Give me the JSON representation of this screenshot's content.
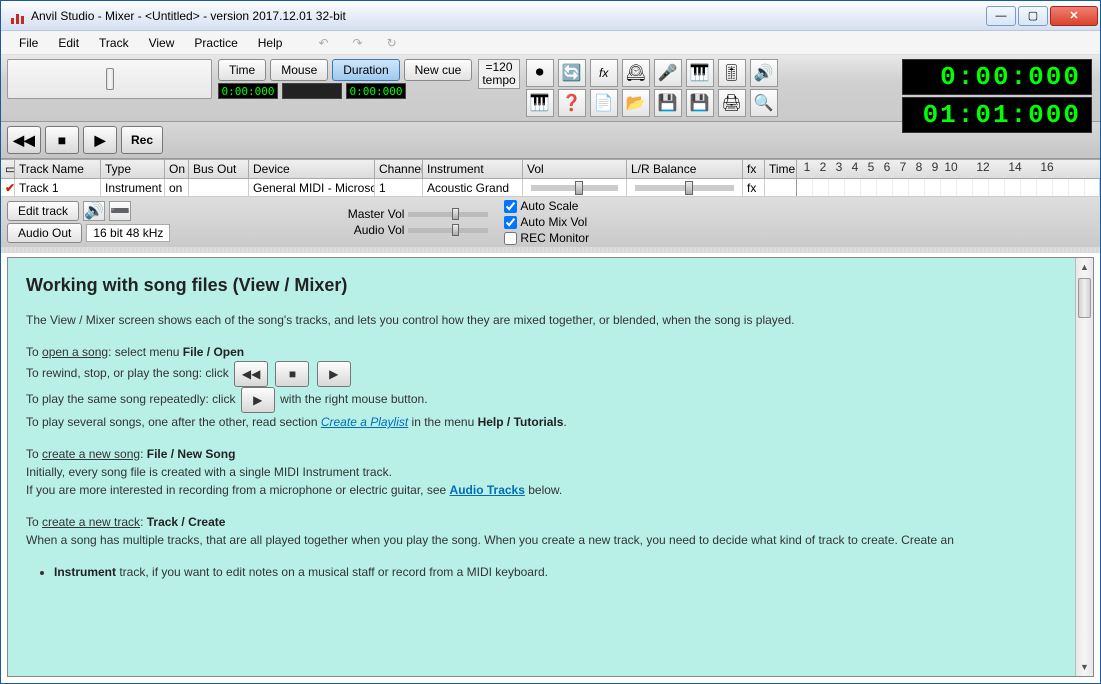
{
  "window": {
    "title": "Anvil Studio - Mixer - <Untitled> - version 2017.12.01 32-bit"
  },
  "menu": {
    "file": "File",
    "edit": "Edit",
    "track": "Track",
    "view": "View",
    "practice": "Practice",
    "help": "Help"
  },
  "toolbar": {
    "time": "Time",
    "mouse": "Mouse",
    "duration": "Duration",
    "newcue": "New cue",
    "time_counter": "0:00:000",
    "dur_counter": "0:00:000",
    "tempo_value": "=120",
    "tempo_label": "tempo",
    "rec": "Rec"
  },
  "bigtime": {
    "elapsed": "0:00:000",
    "position": "01:01:000"
  },
  "columns": {
    "trackname": "Track Name",
    "type": "Type",
    "on": "On",
    "busout": "Bus Out",
    "device": "Device",
    "channel": "Channel",
    "instrument": "Instrument",
    "vol": "Vol",
    "balance": "L/R Balance",
    "fx": "fx",
    "time": "Time"
  },
  "ruler": [
    "1",
    "2",
    "3",
    "4",
    "5",
    "6",
    "7",
    "8",
    "9",
    "10",
    "",
    "12",
    "",
    "14",
    "",
    "16"
  ],
  "track1": {
    "name": "Track 1",
    "type": "Instrument",
    "on": "on",
    "busout": "",
    "device": "General MIDI - Microso",
    "channel": "1",
    "instrument": "Acoustic Grand",
    "fx": "fx"
  },
  "mid": {
    "edit_track": "Edit track",
    "audio_out": "Audio Out",
    "audio_fmt": "16 bit 48 kHz",
    "master_vol": "Master Vol",
    "audio_vol": "Audio Vol",
    "auto_scale": "Auto Scale",
    "auto_mix": "Auto Mix Vol",
    "rec_monitor": "REC Monitor"
  },
  "help": {
    "heading": "Working with song files (View / Mixer)",
    "p1": "The View / Mixer screen shows each of the song's tracks, and lets you control how they are mixed together, or blended, when the song is played.",
    "open_pre": "To ",
    "open_u": "open a song",
    "open_post": ": select menu ",
    "open_b": "File / Open",
    "rewind": "To rewind, stop, or play the song: click ",
    "repeat_pre": "To play the same song repeatedly: click ",
    "repeat_post": " with the right mouse button.",
    "playlist_pre": "To play several songs, one after the other, read section ",
    "playlist_link": "Create a Playlist",
    "playlist_mid": " in the menu ",
    "playlist_b": "Help / Tutorials",
    "playlist_post": ".",
    "newsong_pre": "To ",
    "newsong_u": "create a new song",
    "newsong_post": ": ",
    "newsong_b": "File / New Song",
    "newsong_l1": "Initially, every song file is created with a single MIDI Instrument track.",
    "newsong_l2a": "If you are more interested in recording from a microphone or electric guitar, see ",
    "newsong_link": "Audio Tracks",
    "newsong_l2b": " below.",
    "newtrack_pre": "To ",
    "newtrack_u": "create a new track",
    "newtrack_post": ": ",
    "newtrack_b": "Track / Create",
    "newtrack_body": "When a song has multiple tracks, that are all played together when you play the song. When you create a new track, you need to decide what kind of track to create. Create an",
    "li1_b": "Instrument",
    "li1": " track, if you want to edit notes on a musical staff or record from a MIDI keyboard."
  }
}
